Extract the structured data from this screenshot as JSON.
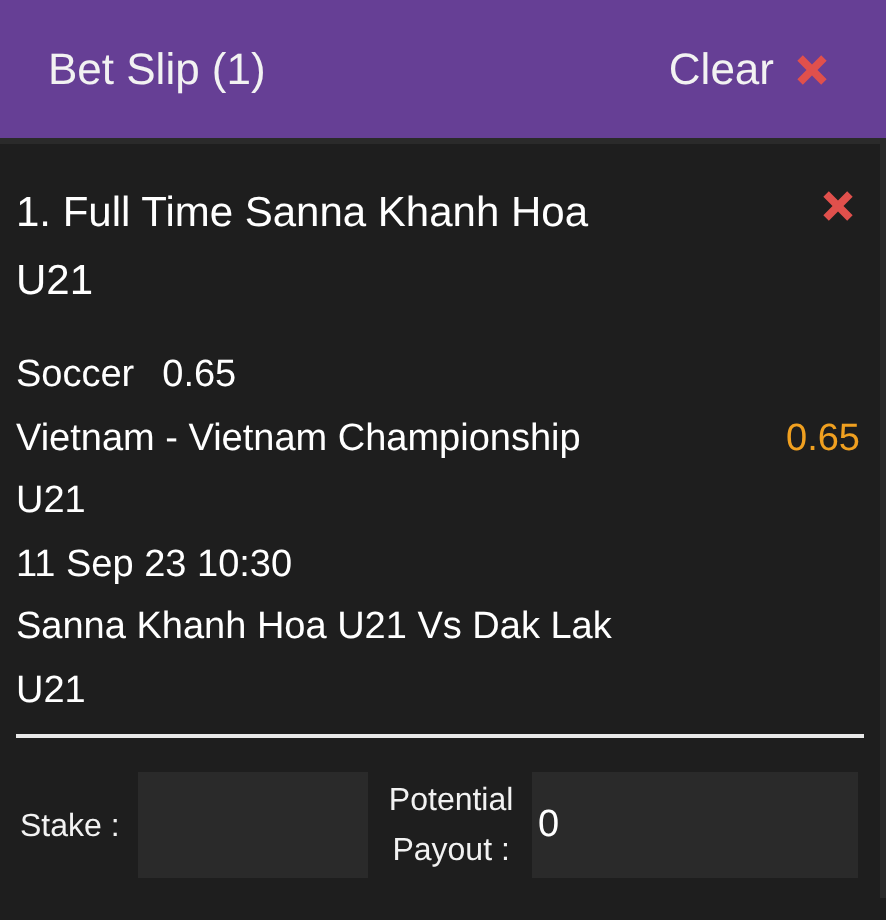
{
  "header": {
    "title": "Bet Slip (1)",
    "clear_label": "Clear"
  },
  "selections": [
    {
      "title": "1. Full Time Sanna Khanh Hoa U21",
      "sport": "Soccer",
      "sport_odds": "0.65",
      "competition": "Vietnam - Vietnam Championship U21",
      "price": "0.65",
      "date": "11 Sep 23 10:30",
      "match": "Sanna Khanh Hoa U21 Vs Dak Lak U21"
    }
  ],
  "stake": {
    "label": "Stake :"
  },
  "payout": {
    "label": "Potential Payout :",
    "value": "0"
  }
}
